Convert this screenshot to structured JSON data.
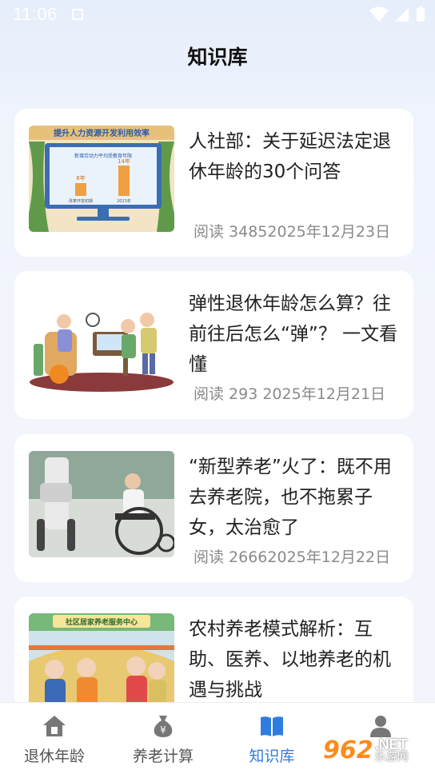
{
  "status_bar": {
    "time": "11:06"
  },
  "header": {
    "title": "知识库"
  },
  "thumb1": {
    "banner": "提升人力资源开发利用效率",
    "chart_caption": "新增劳动力平均受教育年限",
    "bar_label_1": "8年",
    "bar_label_2": "14年",
    "x_label_1": "改革开放初期",
    "x_label_2": "2023年"
  },
  "thumb4": {
    "sign": "社区居家养老服务中心"
  },
  "articles": [
    {
      "title": "人社部：关于延迟法定退休年龄的30个问答",
      "meta": "阅读 34852025年12月23日"
    },
    {
      "title": "弹性退休年龄怎么算？往前往后怎么“弹”？ 一文看懂",
      "meta": "阅读 293   2025年12月21日"
    },
    {
      "title": "“新型养老”火了：既不用去养老院，也不拖累子女，太治愈了",
      "meta": "阅读 26662025年12月22日"
    },
    {
      "title": "农村养老模式解析：互助、医养、以地养老的机遇与挑战",
      "meta": ""
    }
  ],
  "tabbar": {
    "tabs": [
      {
        "label": "退休年龄",
        "icon": "house-icon"
      },
      {
        "label": "养老计算",
        "icon": "money-bag-icon"
      },
      {
        "label": "知识库",
        "icon": "book-icon"
      },
      {
        "label": "我的",
        "icon": "user-icon"
      }
    ],
    "active_color": "#2f7de1"
  },
  "watermark": {
    "number": "962",
    "suffix": ".NET",
    "cn": "乐游网"
  }
}
